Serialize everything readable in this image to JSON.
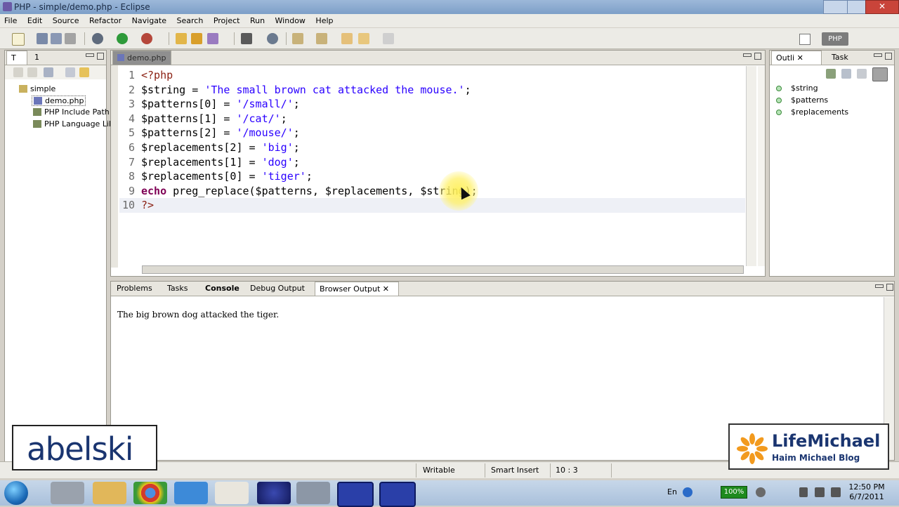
{
  "window": {
    "title": "PHP - simple/demo.php - Eclipse"
  },
  "menu": [
    "File",
    "Edit",
    "Source",
    "Refactor",
    "Navigate",
    "Search",
    "Project",
    "Run",
    "Window",
    "Help"
  ],
  "perspective": {
    "label": "PHP"
  },
  "explorer": {
    "tabs": {
      "first": "T",
      "second": "1"
    },
    "project": "simple",
    "items": [
      "demo.php",
      "PHP Include Path",
      "PHP Language Library"
    ]
  },
  "editor": {
    "tab": "demo.php",
    "lines": [
      {
        "n": "1",
        "tokens": [
          [
            "tag",
            "<?php"
          ]
        ]
      },
      {
        "n": "2",
        "tokens": [
          [
            "var",
            "$string = "
          ],
          [
            "str",
            "'The small brown cat attacked the mouse.'"
          ],
          [
            "var",
            ";"
          ]
        ]
      },
      {
        "n": "3",
        "tokens": [
          [
            "var",
            "$patterns[0] = "
          ],
          [
            "str",
            "'/small/'"
          ],
          [
            "var",
            ";"
          ]
        ]
      },
      {
        "n": "4",
        "tokens": [
          [
            "var",
            "$patterns[1] = "
          ],
          [
            "str",
            "'/cat/'"
          ],
          [
            "var",
            ";"
          ]
        ]
      },
      {
        "n": "5",
        "tokens": [
          [
            "var",
            "$patterns[2] = "
          ],
          [
            "str",
            "'/mouse/'"
          ],
          [
            "var",
            ";"
          ]
        ]
      },
      {
        "n": "6",
        "tokens": [
          [
            "var",
            "$replacements[2] = "
          ],
          [
            "str",
            "'big'"
          ],
          [
            "var",
            ";"
          ]
        ]
      },
      {
        "n": "7",
        "tokens": [
          [
            "var",
            "$replacements[1] = "
          ],
          [
            "str",
            "'dog'"
          ],
          [
            "var",
            ";"
          ]
        ]
      },
      {
        "n": "8",
        "tokens": [
          [
            "var",
            "$replacements[0] = "
          ],
          [
            "str",
            "'tiger'"
          ],
          [
            "var",
            ";"
          ]
        ]
      },
      {
        "n": "9",
        "tokens": [
          [
            "kw",
            "echo"
          ],
          [
            "var",
            " preg_replace($patterns, $replacements, $string);"
          ]
        ]
      },
      {
        "n": "10",
        "tokens": [
          [
            "tag",
            "?>"
          ]
        ]
      }
    ]
  },
  "outline": {
    "tabs": {
      "outline": "Outli",
      "tasks": "Task"
    },
    "items": [
      "$string",
      "$patterns",
      "$replacements"
    ]
  },
  "bottom": {
    "tabs": [
      "Problems",
      "Tasks",
      "Console",
      "Debug Output",
      "Browser Output"
    ],
    "output": "The big brown dog attacked the tiger."
  },
  "status": {
    "writable": "Writable",
    "mode": "Smart Insert",
    "position": "10 : 3"
  },
  "overlays": {
    "left_brand": "abelski",
    "right_brand": "LifeMichael",
    "right_sub": "Haim Michael Blog"
  },
  "taskbar": {
    "lang": "En",
    "battery": "100%",
    "time": "12:50 PM",
    "date": "6/7/2011"
  },
  "colors": {
    "keyword": "#7f0055",
    "string": "#2a00ff",
    "php_tag": "#8a1f11"
  }
}
